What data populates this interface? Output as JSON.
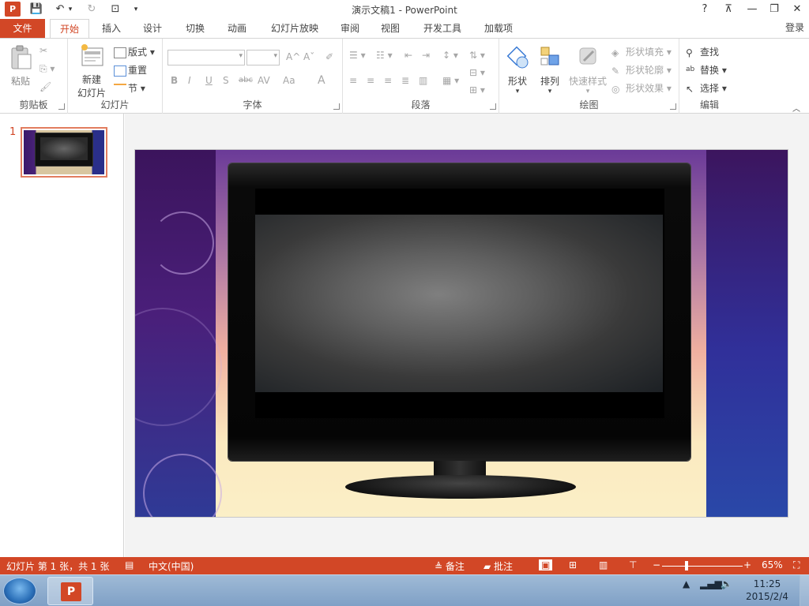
{
  "titlebar": {
    "title": "演示文稿1 - PowerPoint",
    "help": "?",
    "ribbon_display": "⊼",
    "minimize": "—",
    "restore": "❐",
    "close": "✕"
  },
  "quick_access": {
    "save": "💾",
    "undo": "↶",
    "redo": "↻",
    "start_from": "⊡",
    "customize": "▾"
  },
  "tabs": [
    {
      "label": "文件"
    },
    {
      "label": "开始"
    },
    {
      "label": "插入"
    },
    {
      "label": "设计"
    },
    {
      "label": "切换"
    },
    {
      "label": "动画"
    },
    {
      "label": "幻灯片放映"
    },
    {
      "label": "审阅"
    },
    {
      "label": "视图"
    },
    {
      "label": "开发工具"
    },
    {
      "label": "加载项"
    }
  ],
  "signin": "登录",
  "ribbon": {
    "clipboard": {
      "label": "剪贴板",
      "paste": "粘贴"
    },
    "slides": {
      "label": "幻灯片",
      "new_slide_line1": "新建",
      "new_slide_line2": "幻灯片",
      "layout": "版式",
      "reset": "重置",
      "section": "节"
    },
    "font": {
      "label": "字体",
      "bold": "B",
      "italic": "I",
      "underline": "U",
      "shadow": "S",
      "strike": "abc",
      "spacing": "AV",
      "case": "Aa",
      "color": "A",
      "grow": "A^",
      "shrink": "Aˇ"
    },
    "paragraph": {
      "label": "段落"
    },
    "drawing": {
      "label": "绘图",
      "shapes": "形状",
      "arrange": "排列",
      "quick_styles": "快速样式",
      "shape_fill": "形状填充",
      "shape_outline": "形状轮廓",
      "shape_effects": "形状效果"
    },
    "editing": {
      "label": "编辑",
      "find": "查找",
      "replace": "替换",
      "select": "选择"
    }
  },
  "thumbnails": [
    {
      "number": "1"
    }
  ],
  "statusbar": {
    "slide_info": "幻灯片 第 1 张，共 1 张",
    "language": "中文(中国)",
    "notes": "备注",
    "comments": "批注",
    "zoom_minus": "−",
    "zoom_plus": "+",
    "zoom": "65%"
  },
  "taskbar": {
    "time": "11:25",
    "date": "2015/2/4"
  },
  "colors": {
    "accent": "#d24726"
  }
}
